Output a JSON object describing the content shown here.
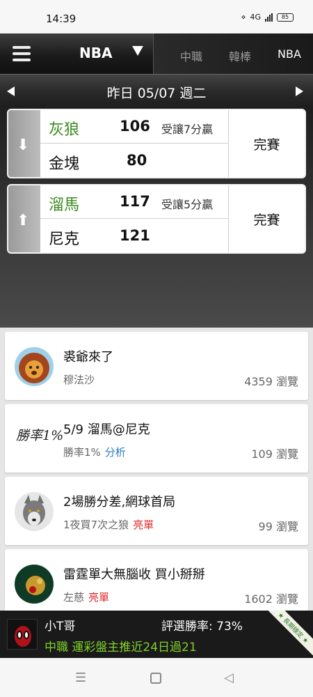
{
  "status_bar": {
    "time": "14:39",
    "battery": "85",
    "network": "4G"
  },
  "nav": {
    "league": "NBA",
    "tabs": [
      "中職",
      "韓棒",
      "NBA"
    ],
    "date": "昨日 05/07 週二"
  },
  "games": [
    {
      "team1": "灰狼",
      "score1": "106",
      "spread": "受讓7分贏",
      "team2": "金塊",
      "score2": "80",
      "status": "完賽",
      "trend_icon": "down-arrow-icon"
    },
    {
      "team1": "溜馬",
      "score1": "117",
      "spread": "受讓5分贏",
      "team2": "尼克",
      "score2": "121",
      "status": "完賽",
      "trend_icon": "up-arrow-icon"
    }
  ],
  "articles": [
    {
      "title": "裘爺來了",
      "author": "穆法沙",
      "tag": "",
      "views": "4359 瀏覽",
      "avatar": "lion-avatar"
    },
    {
      "title": "5/9 溜馬@尼克",
      "author": "勝率1%",
      "tag": "分析",
      "views": "109 瀏覽",
      "avatar": "calligraphy-avatar",
      "avatar_text": "勝率1%"
    },
    {
      "title": "2場勝分差,網球首局",
      "author": "1夜買7次之狼",
      "tag": "亮單",
      "views": "99 瀏覽",
      "avatar": "wolf-avatar"
    },
    {
      "title": "雷霆單大無腦收 買小掰掰",
      "author": "左慈",
      "tag": "亮單",
      "views": "1602 瀏覽",
      "avatar": "dragon-avatar"
    }
  ],
  "promo": {
    "name": "小T哥",
    "rate": "評選勝率: 73%",
    "message": "中職 運彩盤主推近24日過21",
    "ribbon": "★ 長期穩定 ★"
  },
  "colors": {
    "green": "#3a8a1e",
    "blue": "#2a7dc1",
    "red": "#e0262a",
    "promo_green": "#7fd12a"
  }
}
